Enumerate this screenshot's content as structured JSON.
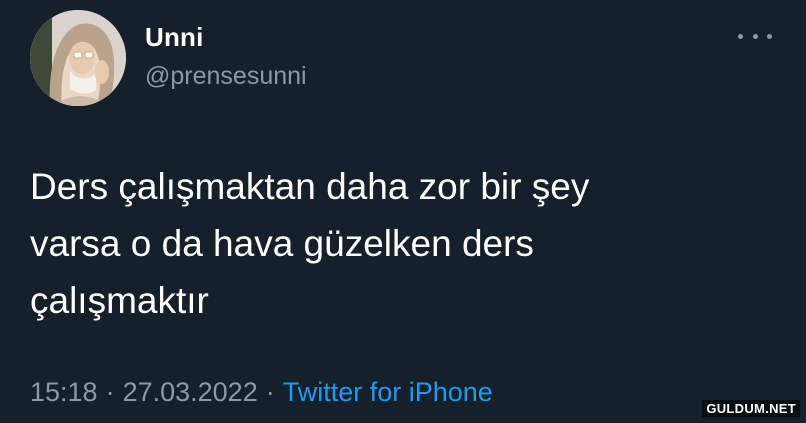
{
  "user": {
    "display_name": "Unni",
    "handle": "@prensesunni",
    "avatar_icon": "profile-photo"
  },
  "tweet": {
    "lines": [
      "Ders çalışmaktan daha zor bir şey",
      "varsa o da hava güzelken ders",
      "çalışmaktır"
    ],
    "time": "15:18",
    "separator": "·",
    "date": "27.03.2022",
    "source": "Twitter for iPhone"
  },
  "menu": {
    "icon": "more-horizontal-icon"
  },
  "watermark": "GULDUM.NET",
  "colors": {
    "background": "#15202b",
    "text": "#ffffff",
    "secondary": "#8b98a5",
    "link": "#1d9bf0"
  }
}
